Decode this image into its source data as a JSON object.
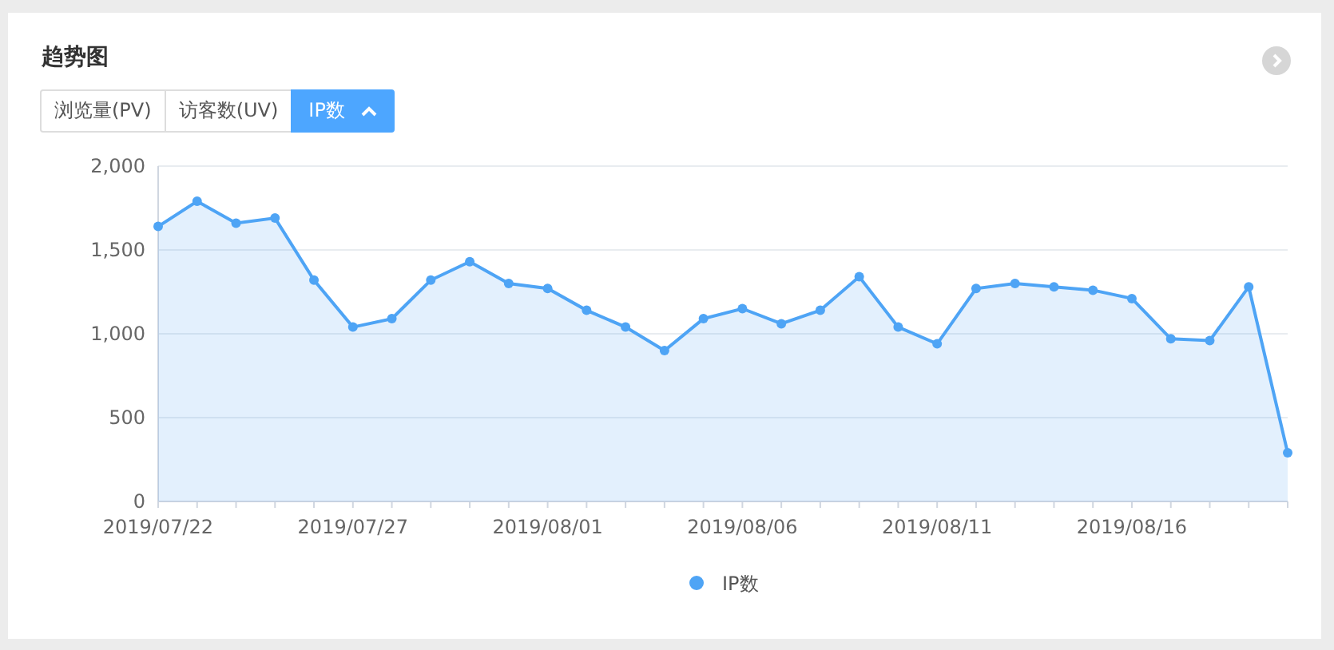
{
  "title": "趋势图",
  "tabs": [
    {
      "label": "浏览量(PV)",
      "selected": false
    },
    {
      "label": "访客数(UV)",
      "selected": false
    },
    {
      "label": "IP数",
      "selected": true
    }
  ],
  "chart_data": {
    "type": "area",
    "grid": true,
    "categories": [
      "2019/07/22",
      null,
      null,
      null,
      null,
      "2019/07/27",
      null,
      null,
      null,
      null,
      "2019/08/01",
      null,
      null,
      null,
      null,
      "2019/08/06",
      null,
      null,
      null,
      null,
      "2019/08/11",
      null,
      null,
      null,
      null,
      "2019/08/16",
      null,
      null,
      null,
      null
    ],
    "ylim": [
      0,
      2000
    ],
    "yticks": [
      0,
      {
        "value": 500,
        "label": "500"
      },
      {
        "value": 1000,
        "label": "1,000"
      },
      {
        "value": 1500,
        "label": "1,500"
      },
      {
        "value": 2000,
        "label": "2,000"
      }
    ],
    "series": [
      {
        "name": "IP数",
        "color": "#4ea4f5",
        "values": [
          1640,
          1790,
          1660,
          1690,
          1320,
          1040,
          1090,
          1320,
          1430,
          1300,
          1270,
          1140,
          1040,
          900,
          1090,
          1150,
          1060,
          1140,
          1340,
          1040,
          940,
          1270,
          1300,
          1280,
          1260,
          1210,
          970,
          960,
          1280,
          290
        ]
      }
    ]
  }
}
